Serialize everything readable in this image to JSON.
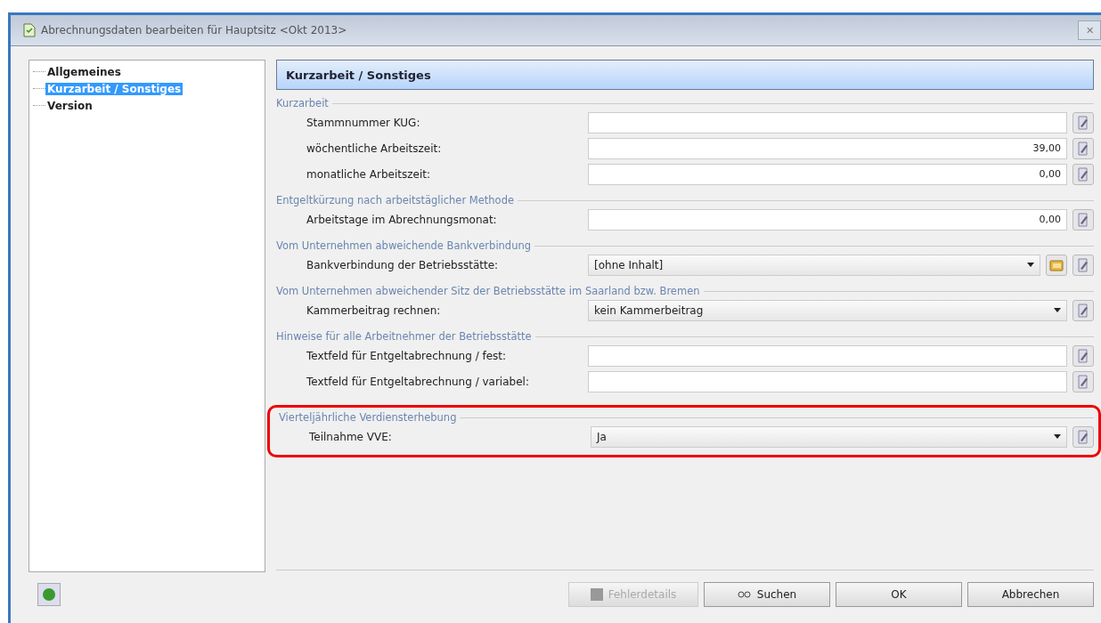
{
  "window": {
    "title": "Abrechnungsdaten bearbeiten für Hauptsitz <Okt 2013>",
    "close": "✕"
  },
  "tree": [
    {
      "label": "Allgemeines",
      "selected": false
    },
    {
      "label": "Kurzarbeit / Sonstiges",
      "selected": true
    },
    {
      "label": "Version",
      "selected": false
    }
  ],
  "panel": {
    "title": "Kurzarbeit / Sonstiges"
  },
  "sections": [
    {
      "title": "Kurzarbeit",
      "highlighted": false,
      "rows": [
        {
          "label": "Stammnummer KUG:",
          "kind": "text",
          "value": "",
          "lookup": false
        },
        {
          "label": "wöchentliche Arbeitszeit:",
          "kind": "text",
          "value": "39,00",
          "lookup": false
        },
        {
          "label": "monatliche Arbeitszeit:",
          "kind": "text",
          "value": "0,00",
          "lookup": false
        }
      ]
    },
    {
      "title": "Entgeltkürzung nach arbeitstäglicher Methode",
      "highlighted": false,
      "rows": [
        {
          "label": "Arbeitstage im Abrechnungsmonat:",
          "kind": "text",
          "value": "0,00",
          "lookup": false
        }
      ]
    },
    {
      "title": "Vom Unternehmen abweichende Bankverbindung",
      "highlighted": false,
      "rows": [
        {
          "label": "Bankverbindung der Betriebsstätte:",
          "kind": "select",
          "value": "[ohne Inhalt]",
          "lookup": true
        }
      ]
    },
    {
      "title": "Vom Unternehmen abweichender Sitz der Betriebsstätte im Saarland bzw. Bremen",
      "highlighted": false,
      "rows": [
        {
          "label": "Kammerbeitrag rechnen:",
          "kind": "select",
          "value": "kein Kammerbeitrag",
          "lookup": false
        }
      ]
    },
    {
      "title": "Hinweise für alle Arbeitnehmer der Betriebsstätte",
      "highlighted": false,
      "rows": [
        {
          "label": "Textfeld für Entgeltabrechnung / fest:",
          "kind": "text",
          "value": "",
          "lookup": false
        },
        {
          "label": "Textfeld für Entgeltabrechnung / variabel:",
          "kind": "text",
          "value": "",
          "lookup": false
        }
      ]
    },
    {
      "title": "Vierteljährliche Verdiensterhebung",
      "highlighted": true,
      "rows": [
        {
          "label": "Teilnahme VVE:",
          "kind": "select",
          "value": "Ja",
          "lookup": false
        }
      ]
    }
  ],
  "buttons": [
    {
      "label": "Fehlerdetails",
      "kind": "details",
      "disabled": true
    },
    {
      "label": "Suchen",
      "kind": "search",
      "disabled": false
    },
    {
      "label": "OK",
      "kind": "plain",
      "disabled": false
    },
    {
      "label": "Abbrechen",
      "kind": "plain",
      "disabled": false
    }
  ]
}
